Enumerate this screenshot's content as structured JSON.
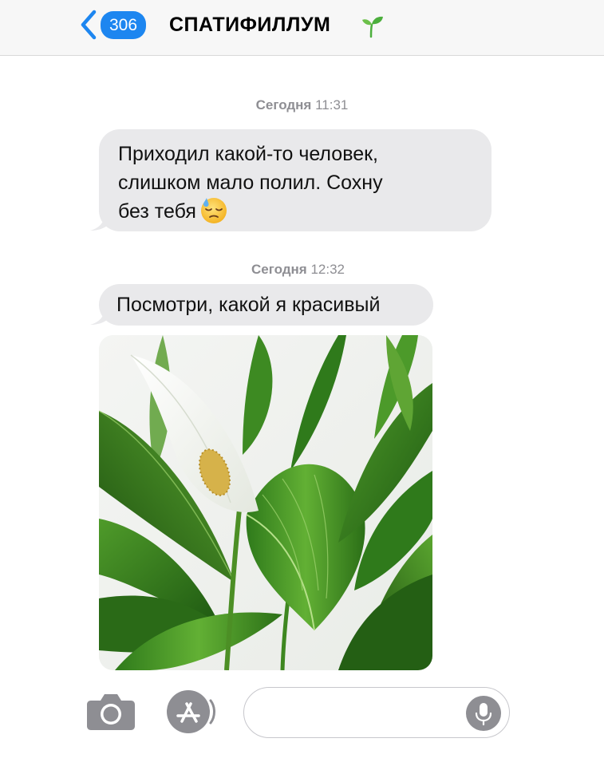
{
  "header": {
    "back_count": "306",
    "title": "СПАТИФИЛЛУМ",
    "title_icon": "sprout-icon"
  },
  "messages": [
    {
      "timestamp_day": "Сегодня",
      "timestamp_time": "11:31",
      "lines": [
        "Приходил какой-то человек,",
        "слишком мало полил. Сохну",
        "без тебя"
      ],
      "emoji": "downcast-face-with-sweat-icon"
    },
    {
      "timestamp_day": "Сегодня",
      "timestamp_time": "12:32",
      "text": "Посмотри, какой я красивый",
      "attachment": "peace-lily-photo"
    }
  ],
  "input_bar": {
    "placeholder": "",
    "icons": [
      "camera-icon",
      "app-store-icon",
      "microphone-icon"
    ]
  },
  "colors": {
    "accent": "#1d86f0",
    "bubble": "#e9e9eb",
    "timestamp": "#8e8e93",
    "header_bg": "#f7f7f7"
  }
}
